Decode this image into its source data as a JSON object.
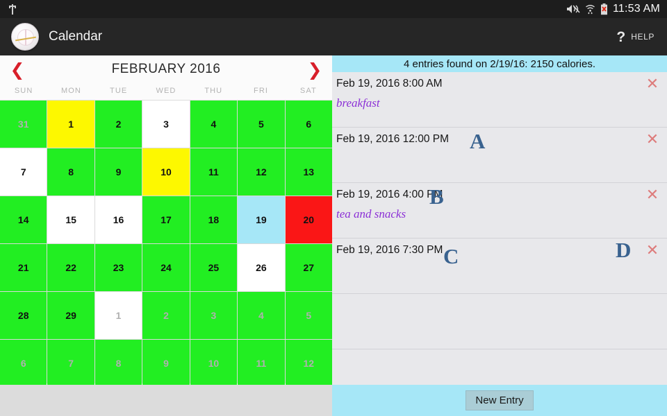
{
  "status_bar": {
    "usb_icon": "usb-icon",
    "mute_icon": "volume-mute-icon",
    "wifi_icon": "wifi-icon",
    "battery_icon": "battery-error-icon",
    "time": "11:53 AM"
  },
  "app_bar": {
    "logo_icon": "plate-fork-app-icon",
    "title": "Calendar",
    "help_icon": "question-mark-icon",
    "help_label": "HELP"
  },
  "calendar": {
    "prev_icon": "chevron-left-icon",
    "next_icon": "chevron-right-icon",
    "month_label": "FEBRUARY 2016",
    "day_headers": [
      "SUN",
      "MON",
      "TUE",
      "WED",
      "THU",
      "FRI",
      "SAT"
    ],
    "colors": {
      "green": "#22ee22",
      "yellow": "#fdf800",
      "white": "#ffffff",
      "red": "#fa1616",
      "selected_blue": "#a6e7f7",
      "grid_line": "#d9d9d9"
    },
    "cells": [
      {
        "day": "31",
        "color": "green",
        "muted": true,
        "other_month": true
      },
      {
        "day": "1",
        "color": "yellow",
        "muted": false,
        "other_month": false
      },
      {
        "day": "2",
        "color": "green",
        "muted": false,
        "other_month": false
      },
      {
        "day": "3",
        "color": "white",
        "muted": false,
        "other_month": false
      },
      {
        "day": "4",
        "color": "green",
        "muted": false,
        "other_month": false
      },
      {
        "day": "5",
        "color": "green",
        "muted": false,
        "other_month": false
      },
      {
        "day": "6",
        "color": "green",
        "muted": false,
        "other_month": false
      },
      {
        "day": "7",
        "color": "white",
        "muted": false,
        "other_month": false
      },
      {
        "day": "8",
        "color": "green",
        "muted": false,
        "other_month": false
      },
      {
        "day": "9",
        "color": "green",
        "muted": false,
        "other_month": false
      },
      {
        "day": "10",
        "color": "yellow",
        "muted": false,
        "other_month": false
      },
      {
        "day": "11",
        "color": "green",
        "muted": false,
        "other_month": false
      },
      {
        "day": "12",
        "color": "green",
        "muted": false,
        "other_month": false
      },
      {
        "day": "13",
        "color": "green",
        "muted": false,
        "other_month": false
      },
      {
        "day": "14",
        "color": "green",
        "muted": false,
        "other_month": false
      },
      {
        "day": "15",
        "color": "white",
        "muted": false,
        "other_month": false
      },
      {
        "day": "16",
        "color": "white",
        "muted": false,
        "other_month": false
      },
      {
        "day": "17",
        "color": "green",
        "muted": false,
        "other_month": false
      },
      {
        "day": "18",
        "color": "green",
        "muted": false,
        "other_month": false
      },
      {
        "day": "19",
        "color": "selected_blue",
        "muted": false,
        "other_month": false,
        "selected": true
      },
      {
        "day": "20",
        "color": "red",
        "muted": false,
        "other_month": false
      },
      {
        "day": "21",
        "color": "green",
        "muted": false,
        "other_month": false
      },
      {
        "day": "22",
        "color": "green",
        "muted": false,
        "other_month": false
      },
      {
        "day": "23",
        "color": "green",
        "muted": false,
        "other_month": false
      },
      {
        "day": "24",
        "color": "green",
        "muted": false,
        "other_month": false
      },
      {
        "day": "25",
        "color": "green",
        "muted": false,
        "other_month": false
      },
      {
        "day": "26",
        "color": "white",
        "muted": false,
        "other_month": false
      },
      {
        "day": "27",
        "color": "green",
        "muted": false,
        "other_month": false
      },
      {
        "day": "28",
        "color": "green",
        "muted": false,
        "other_month": false
      },
      {
        "day": "29",
        "color": "green",
        "muted": false,
        "other_month": false
      },
      {
        "day": "1",
        "color": "white",
        "muted": true,
        "other_month": true
      },
      {
        "day": "2",
        "color": "green",
        "muted": true,
        "other_month": true
      },
      {
        "day": "3",
        "color": "green",
        "muted": true,
        "other_month": true
      },
      {
        "day": "4",
        "color": "green",
        "muted": true,
        "other_month": true
      },
      {
        "day": "5",
        "color": "green",
        "muted": true,
        "other_month": true
      },
      {
        "day": "6",
        "color": "green",
        "muted": true,
        "other_month": true
      },
      {
        "day": "7",
        "color": "green",
        "muted": true,
        "other_month": true
      },
      {
        "day": "8",
        "color": "green",
        "muted": true,
        "other_month": true
      },
      {
        "day": "9",
        "color": "green",
        "muted": true,
        "other_month": true
      },
      {
        "day": "10",
        "color": "green",
        "muted": true,
        "other_month": true
      },
      {
        "day": "11",
        "color": "green",
        "muted": true,
        "other_month": true
      },
      {
        "day": "12",
        "color": "green",
        "muted": true,
        "other_month": true
      }
    ]
  },
  "entries_panel": {
    "summary": "4 entries found on 2/19/16: 2150 calories.",
    "delete_icon": "close-x-icon",
    "entries": [
      {
        "time": "Feb 19, 2016 8:00 AM",
        "description": "breakfast"
      },
      {
        "time": "Feb 19, 2016 12:00 PM",
        "description": ""
      },
      {
        "time": "Feb 19, 2016 4:00 PM",
        "description": "tea and snacks"
      },
      {
        "time": "Feb 19, 2016 7:30 PM",
        "description": ""
      }
    ],
    "footer": {
      "new_entry_label": "New Entry"
    }
  },
  "annotation_marks": {
    "a": "A",
    "b": "B",
    "c": "C",
    "d": "D"
  }
}
